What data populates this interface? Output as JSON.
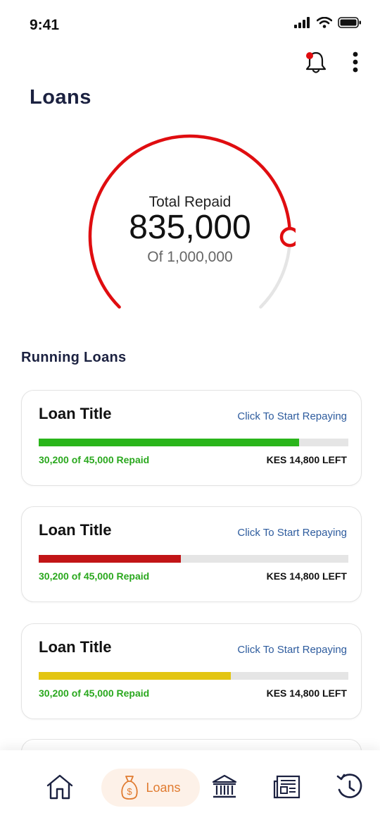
{
  "status_bar": {
    "time": "9:41"
  },
  "header": {
    "title": "Loans"
  },
  "summary": {
    "label": "Total Repaid",
    "value": "835,000",
    "subtext": "Of 1,000,000",
    "progress": 0.835,
    "accent_color": "#e00d10",
    "track_color": "#e5e5e5"
  },
  "running_loans": {
    "title": "Running Loans",
    "items": [
      {
        "title": "Loan Title",
        "action": "Click To Start Repaying",
        "repaid_text": "30,200 of 45,000 Repaid",
        "left_text": "KES 14,800 LEFT",
        "progress": 0.84,
        "color": "#2ab51b"
      },
      {
        "title": "Loan Title",
        "action": "Click To Start Repaying",
        "repaid_text": "30,200 of 45,000 Repaid",
        "left_text": "KES 14,800 LEFT",
        "progress": 0.46,
        "color": "#c21517"
      },
      {
        "title": "Loan Title",
        "action": "Click To Start Repaying",
        "repaid_text": "30,200 of 45,000 Repaid",
        "left_text": "KES 14,800 LEFT",
        "progress": 0.62,
        "color": "#e3c512"
      }
    ]
  },
  "nav": {
    "items": [
      {
        "icon": "home-icon"
      },
      {
        "icon": "money-bag-icon",
        "label": "Loans",
        "active": true
      },
      {
        "icon": "bank-icon"
      },
      {
        "icon": "news-icon"
      },
      {
        "icon": "history-icon"
      }
    ],
    "active_color": "#e07b30",
    "icon_color": "#1b2140"
  }
}
